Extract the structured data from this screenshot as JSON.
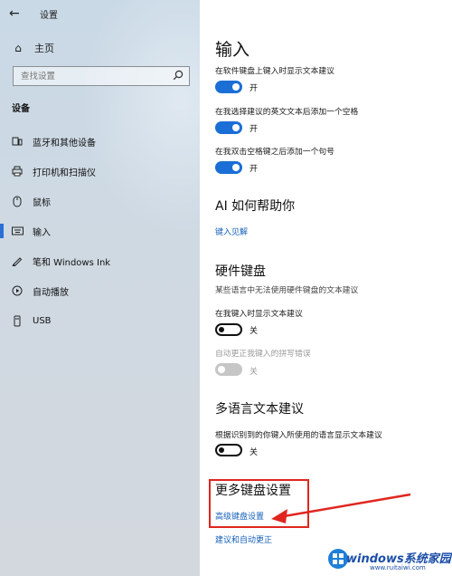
{
  "sidebar": {
    "back_icon": "back-arrow-icon",
    "app_title": "设置",
    "home_label": "主页",
    "search_placeholder": "查找设置",
    "section_label": "设备",
    "items": [
      {
        "label": "蓝牙和其他设备",
        "icon": "bluetooth-devices-icon"
      },
      {
        "label": "打印机和扫描仪",
        "icon": "printer-icon"
      },
      {
        "label": "鼠标",
        "icon": "mouse-icon"
      },
      {
        "label": "输入",
        "icon": "keyboard-icon",
        "active": true
      },
      {
        "label": "笔和 Windows Ink",
        "icon": "pen-icon"
      },
      {
        "label": "自动播放",
        "icon": "autoplay-icon"
      },
      {
        "label": "USB",
        "icon": "usb-icon"
      }
    ]
  },
  "main": {
    "title": "输入",
    "typing": [
      {
        "label": "在软件键盘上键入时显示文本建议",
        "state": "开"
      },
      {
        "label": "在我选择建议的英文文本后添加一个空格",
        "state": "开"
      },
      {
        "label": "在我双击空格键之后添加一个句号",
        "state": "开"
      }
    ],
    "ai_title": "AI 如何帮助你",
    "ai_link": "键入见解",
    "hardware_title": "硬件键盘",
    "hardware_desc": "某些语言中无法使用硬件键盘的文本建议",
    "hardware": [
      {
        "label": "在我键入时显示文本建议",
        "state": "关"
      },
      {
        "label": "自动更正我键入的拼写错误",
        "state": "关"
      }
    ],
    "multi_title": "多语言文本建议",
    "multi_label": "根据识别到的你键入所使用的语言显示文本建议",
    "multi_state": "关",
    "more_title": "更多键盘设置",
    "advanced_link": "高级键盘设置",
    "autocorrect_link": "建议和自动更正"
  },
  "watermark": {
    "text": "windows系统家园",
    "sub": "www.ruitaiwi.com"
  },
  "colors": {
    "accent": "#1b6ed6",
    "link": "#1460b8",
    "highlight": "#e0261f"
  }
}
